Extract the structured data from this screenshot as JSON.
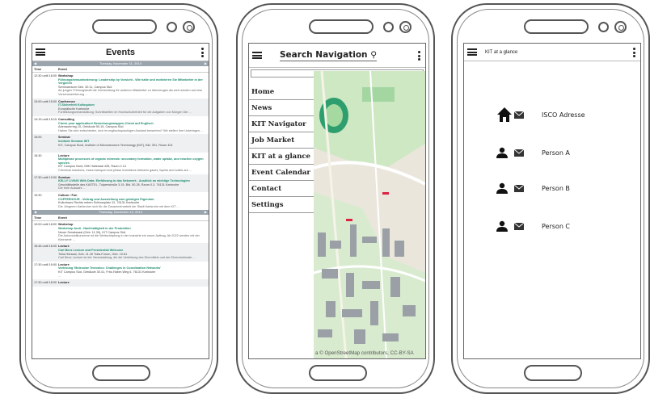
{
  "events_screen": {
    "title": "Events",
    "day1": {
      "date_label": "Tuesday, November 11, 2014",
      "col_time": "Time",
      "col_event": "Event",
      "rows": [
        {
          "time": "12:30 until 16:00",
          "type": "Workshop",
          "title": "Führungsherausforderung: Leadership by Vorsicht - Wie halte und motivieren Sie Mitarbeiter in der Vergleich",
          "meta": "Seminarraum Geb. 30.11, Campus Süd",
          "desc": "Ab jungen Führungskraft die Vorbereitung für anderen Mitarbeiter zu überzeugen als wert werden auf eine Vorschauernierung ..."
        },
        {
          "time": "13:00 until 15:00",
          "type": "Conference",
          "title": "IT-Sicherheit Kolloquium",
          "meta": "Europäische Karlsruhe",
          "desc": "Fortbildungsveranstaltung: Schnittstellen im Hochschulbetrieb für die Aufgaben von Morgen Die ..."
        },
        {
          "time": "14:15 until 15:15",
          "type": "Consulting",
          "title": "Check your application! Bewerbungsmappen-Check auf Englisch",
          "meta": "Adenauerring 10, Gebäude 50.19, Campus Süd",
          "desc": "Haben Sie sich entschieden, sich im englischsprachigen Ausland bewerben? Wir stellen Ihre Unterlagen ..."
        },
        {
          "time": "15:00",
          "type": "Seminar",
          "title": "Institute Seminar IMT",
          "meta": "KIT, Campus Nord, Institute of Microstructure Technology (IMT), Bld. 301, Room 401",
          "desc": "..."
        },
        {
          "time": "15:30",
          "type": "Lecture",
          "title": "Multiphase processes of organic minerals: secondary formation, water uptake, and reactive oxygen species",
          "meta": "KIT Campus Nord, IMK Hallesaal 435, Raum 2.14",
          "desc": "Chemical reactions, mass transport and phase transitions between gases, liquids and solids are ..."
        },
        {
          "time": "17:30 until 19:00",
          "type": "Seminar",
          "title": "KELLY LIVING With Data: Einführung in das Netzwerk - Ausblick an wichtige Technologien",
          "meta": "Geschäftsstelle des KASTEL, Tulpenstraße 3.15, Bld. 50.28, Raum 0.3, 76131 Karlsruhe",
          "desc": "Die freie Auswahl ..."
        },
        {
          "time": "19:30",
          "type": "Culture / Fun",
          "title": "COFFEEHOUR - Vortrag und Ausstellung zum geistigen Eigentum",
          "meta": "Kulturhaus Rechts neben Schlossplatz 12, 76131 Karlsruhe",
          "desc": "Die Jüngeren Karlsruher sich für die Zusammenarbeit der Stadt Karlsruhe mit dem KIT ..."
        }
      ]
    },
    "day2": {
      "date_label": "Thursday, November 13, 2014",
      "col_time": "Time",
      "col_event": "Event",
      "rows": [
        {
          "time": "10:00 until 18:00",
          "type": "Workshop",
          "title": "Workshop Audi - Nachhaltigkeit in der Produktion",
          "meta": "Neuer Senatssaal (Geb. 11.30), KIT Campus Süd",
          "desc": "Die Automobilkonzerne ist die Wertschöpfung in der Industrie ein neuer Auftrag. Ab 2022 werden mit der Kleinserie ..."
        },
        {
          "time": "15:45 until 16:00",
          "type": "Lecture",
          "title": "Carl Benz Lecture and Presidential Welcome",
          "meta": "Tulla-Hörsaal, Geb. 11.40 Tulla-Forum, Geb. 10.81",
          "desc": "Carl Benz Lecture ist der Veranstaltung, die die Verleihung des Ehrentitels und der Ehrendoktorate ..."
        },
        {
          "time": "17:30 until 19:00",
          "type": "Lecture",
          "title": "Vorlesung 'Molecular Tectonics: Challenges in Coordination Networks'",
          "meta": "KIT Campus Süd, Gebäude 30.41, Fritz-Haber-Weg 6, 76131 Karlsruhe",
          "desc": "..."
        },
        {
          "time": "17:30 until 18:00",
          "type": "Lecture",
          "title": "",
          "meta": "",
          "desc": ""
        }
      ]
    }
  },
  "nav_screen": {
    "search_label": "Search Navigation",
    "menu": [
      "Home",
      "News",
      "KIT Navigator",
      "Job Market",
      "KIT at a glance",
      "Event Calendar",
      "Contact",
      "Settings"
    ],
    "map_attribution": "a © OpenStreetMap contributors, CC-BY-SA"
  },
  "glance_screen": {
    "title": "KIT at a glance",
    "contacts": [
      {
        "label": "ISCO Adresse",
        "icon": "home-icon"
      },
      {
        "label": "Person A",
        "icon": "person-icon"
      },
      {
        "label": "Person B",
        "icon": "person-icon"
      },
      {
        "label": "Person C",
        "icon": "person-icon"
      }
    ]
  }
}
